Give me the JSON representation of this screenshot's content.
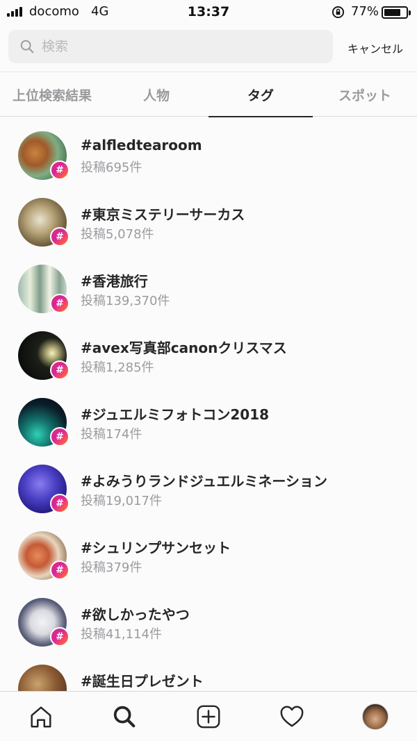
{
  "status_bar": {
    "carrier": "docomo",
    "network": "4G",
    "time": "13:37",
    "battery_percent": "77%",
    "battery_level": 0.77,
    "signal_icon": "signal-bars-icon",
    "lock_icon": "orientation-lock-icon",
    "battery_icon": "battery-icon"
  },
  "search": {
    "placeholder": "検索",
    "value": "",
    "icon": "search-icon",
    "cancel_label": "キャンセル"
  },
  "tabs": [
    {
      "label": "上位検索結果",
      "active": false
    },
    {
      "label": "人物",
      "active": false
    },
    {
      "label": "タグ",
      "active": true
    },
    {
      "label": "スポット",
      "active": false
    }
  ],
  "tags": [
    {
      "name": "#alfledtearoom",
      "count": "投稿695件"
    },
    {
      "name": "#東京ミステリーサーカス",
      "count": "投稿5,078件"
    },
    {
      "name": "#香港旅行",
      "count": "投稿139,370件"
    },
    {
      "name": "#avex写真部canonクリスマス",
      "count": "投稿1,285件"
    },
    {
      "name": "#ジュエルミフォトコン2018",
      "count": "投稿174件"
    },
    {
      "name": "#よみうりランドジュエルミネーション",
      "count": "投稿19,017件"
    },
    {
      "name": "#シュリンプサンセット",
      "count": "投稿379件"
    },
    {
      "name": "#欲しかったやつ",
      "count": "投稿41,114件"
    },
    {
      "name": "#誕生日プレゼント",
      "count": ""
    }
  ],
  "badge_symbol": "#",
  "bottom_nav": {
    "items": [
      "home-icon",
      "search-icon",
      "add-post-icon",
      "heart-icon",
      "profile-avatar"
    ],
    "active": "search-icon"
  }
}
